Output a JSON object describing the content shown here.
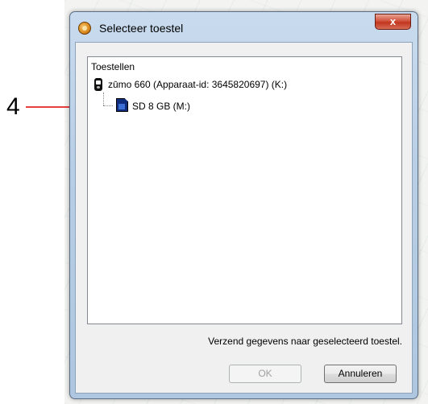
{
  "annotation": {
    "number": "4"
  },
  "window": {
    "title": "Selecteer toestel",
    "close_label": "x"
  },
  "tree": {
    "header": "Toestellen",
    "device": {
      "label": "zūmo 660 (Apparaat-id: 3645820697) (K:)",
      "icon": "gps-device-icon"
    },
    "storage": {
      "label": "SD 8 GB (M:)",
      "icon": "sd-card-icon"
    }
  },
  "footer": {
    "send_text": "Verzend gegevens naar geselecteerd toestel.",
    "ok_label": "OK",
    "cancel_label": "Annuleren"
  },
  "colors": {
    "annotation_arrow": "#e00000",
    "close_button": "#c2361e",
    "sd_card": "#0f2d7a"
  }
}
